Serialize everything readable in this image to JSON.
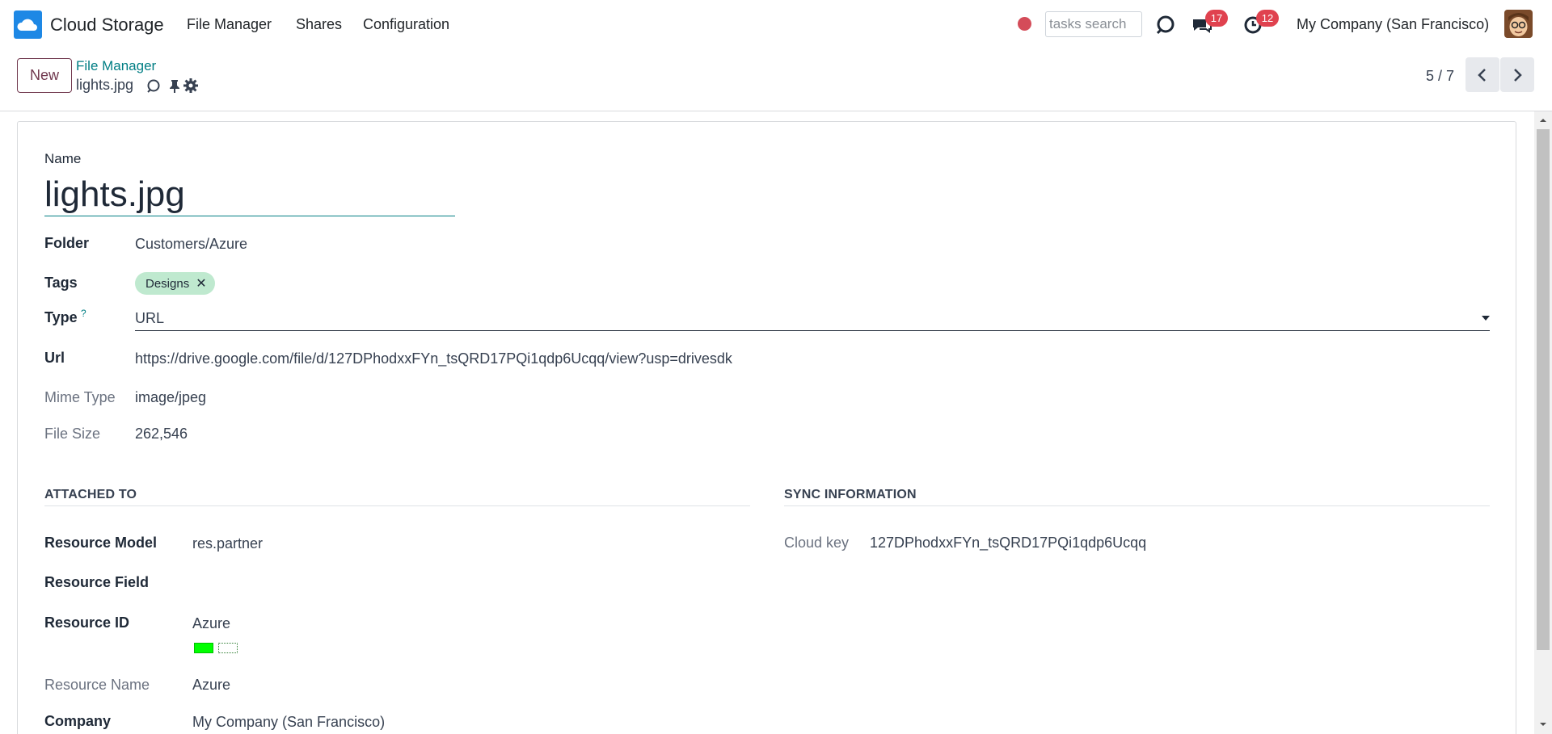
{
  "navbar": {
    "app_name": "Cloud Storage",
    "menu": [
      "File Manager",
      "Shares",
      "Configuration"
    ],
    "search_placeholder": "tasks search",
    "messages_count": "17",
    "activities_count": "12",
    "company": "My Company (San Francisco)",
    "brand_color": "#1e88e5",
    "badge_color": "#e0424f",
    "icons": [
      "cloud-logo-icon",
      "record-dot-icon",
      "refresh-icon",
      "chat-icon",
      "clock-icon",
      "avatar"
    ]
  },
  "control_panel": {
    "new_label": "New",
    "breadcrumb": "File Manager",
    "record_name": "lights.jpg",
    "pager": "5 / 7",
    "icons": [
      "refresh-icon",
      "pin-icon",
      "gear-icon",
      "chevron-left-icon",
      "chevron-right-icon"
    ]
  },
  "form": {
    "name_label": "Name",
    "name_value": "lights.jpg",
    "folder_label": "Folder",
    "folder_value": "Customers/Azure",
    "tags_label": "Tags",
    "tags": [
      {
        "label": "Designs",
        "color": "#bfe9cf"
      }
    ],
    "type_label": "Type",
    "type_help": "?",
    "type_value": "URL",
    "url_label": "Url",
    "url_value": "https://drive.google.com/file/d/127DPhodxxFYn_tsQRD17PQi1qdp6Ucqq/view?usp=drivesdk",
    "mime_label": "Mime Type",
    "mime_value": "image/jpeg",
    "size_label": "File Size",
    "size_value": "262,546"
  },
  "attached_to": {
    "title": "ATTACHED TO",
    "resource_model_label": "Resource Model",
    "resource_model_value": "res.partner",
    "resource_field_label": "Resource Field",
    "resource_field_value": "",
    "resource_id_label": "Resource ID",
    "resource_id_value": "Azure",
    "swatch_color": "#00ff00",
    "resource_name_label": "Resource Name",
    "resource_name_value": "Azure",
    "company_label": "Company",
    "company_value": "My Company (San Francisco)"
  },
  "sync_info": {
    "title": "SYNC INFORMATION",
    "cloud_key_label": "Cloud key",
    "cloud_key_value": "127DPhodxxFYn_tsQRD17PQi1qdp6Ucqq"
  },
  "accent_color": "#017e84",
  "primary_color": "#71394f"
}
